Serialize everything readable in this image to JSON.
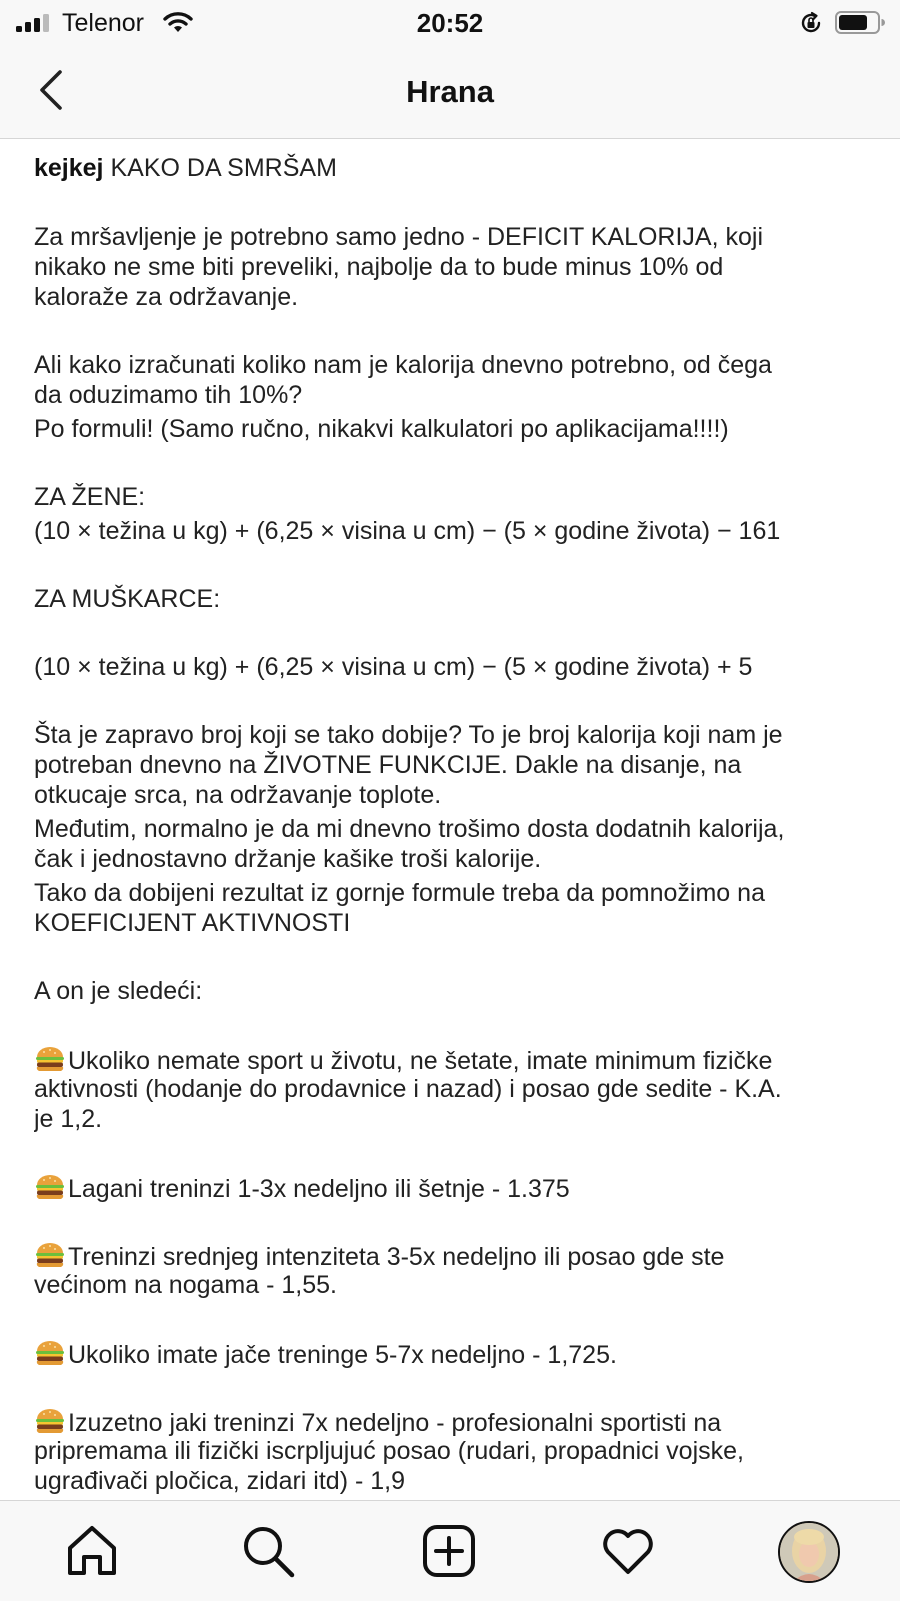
{
  "status_bar": {
    "carrier": "Telenor",
    "time": "20:52"
  },
  "header": {
    "title": "Hrana"
  },
  "post": {
    "username": "kejkej",
    "lines": [
      {
        "text": "KAKO DA SMRŠAM",
        "with_username": true
      },
      {
        "text": "Za mršavljenje je potrebno samo jedno - DEFICIT KALORIJA, koji"
      },
      {
        "text": "nikako ne sme biti preveliki, najbolje da to bude minus 10% od"
      },
      {
        "text": "kaloraže za održavanje."
      },
      {
        "text": "Ali kako izračunati koliko nam je kalorija dnevno potrebno, od čega"
      },
      {
        "text": "da oduzimamo tih 10%?"
      },
      {
        "text": "Po formuli! (Samo ručno, nikakvi kalkulatori po aplikacijama!!!!)"
      },
      {
        "text": "ZA ŽENE:"
      },
      {
        "text": "(10 × težina u kg) + (6,25 × visina u cm) − (5 × godine života) − 161"
      },
      {
        "text": "ZA MUŠKARCE:"
      },
      {
        "text": "(10 × težina u kg) + (6,25 × visina u cm) − (5 × godine života) + 5"
      },
      {
        "text": "Šta je zapravo broj koji se tako dobije? To je broj kalorija koji nam je"
      },
      {
        "text": "potreban dnevno na ŽIVOTNE FUNKCIJE. Dakle na disanje, na"
      },
      {
        "text": "otkucaje srca, na održavanje toplote."
      },
      {
        "text": "Međutim, normalno je da mi dnevno trošimo dosta dodatnih kalorija,"
      },
      {
        "text": "čak i jednostavno držanje kašike troši kalorije."
      },
      {
        "text": "Tako da dobijeni rezultat iz gornje formule treba da pomnožimo na"
      },
      {
        "text": "KOEFICIJENT AKTIVNOSTI"
      },
      {
        "text": "A on je sledeći:"
      },
      {
        "text": "Ukoliko nemate sport u životu, ne šetate, imate minimum fizičke",
        "emoji": "hamburger"
      },
      {
        "text": "aktivnosti (hodanje do prodavnice i nazad) i posao gde sedite - K.A."
      },
      {
        "text": "je 1,2."
      },
      {
        "text": "Lagani treninzi 1-3x nedeljno ili šetnje -  1.375",
        "emoji": "hamburger"
      },
      {
        "text": "Treninzi srednjeg intenziteta 3-5x nedeljno ili posao gde ste",
        "emoji": "hamburger"
      },
      {
        "text": "većinom na nogama - 1,55."
      },
      {
        "text": "Ukoliko imate jače treninge 5-7x nedeljno - 1,725.",
        "emoji": "hamburger"
      },
      {
        "text": "Izuzetno jaki treninzi 7x nedeljno - profesionalni sportisti na",
        "emoji": "hamburger"
      },
      {
        "text": "pripremama ili fizički iscrpljujuć posao (rudari, propadnici vojske,"
      },
      {
        "text": "ugrađivači pločica, zidari itd) - 1,9"
      }
    ]
  },
  "tab_bar": {
    "items": [
      "home-icon",
      "search-icon",
      "add-post-icon",
      "activity-heart-icon",
      "profile-avatar"
    ]
  },
  "colors": {
    "bar_background": "#f8f8f8",
    "text": "#222222",
    "divider": "#d6d6d6"
  }
}
